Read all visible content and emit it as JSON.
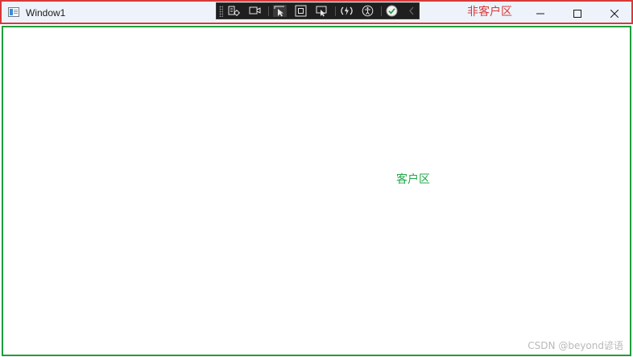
{
  "window": {
    "title": "Window1",
    "non_client_label": "非客户区",
    "client_label": "客户区",
    "watermark": "CSDN @beyond谚语"
  },
  "debug_toolbar": {
    "buttons": [
      {
        "icon": "go-to-live-visual-tree-icon"
      },
      {
        "icon": "show-in-app-toolbar-icon"
      },
      {
        "icon": "select-element-icon"
      },
      {
        "icon": "display-layout-adorners-icon"
      },
      {
        "icon": "track-focused-element-icon"
      },
      {
        "icon": "hot-reload-icon"
      },
      {
        "icon": "accessibility-checker-icon"
      },
      {
        "icon": "binding-status-ok-icon"
      },
      {
        "icon": "collapse-toolbar-icon"
      }
    ]
  },
  "caption_buttons": {
    "minimize_icon": "minimize-icon",
    "maximize_icon": "maximize-icon",
    "close_icon": "close-icon"
  },
  "colors": {
    "non_client_border": "#d9383a",
    "client_border": "#1e9e3a",
    "client_label": "#22a84a",
    "titlebar_bg": "#eef3fb"
  }
}
